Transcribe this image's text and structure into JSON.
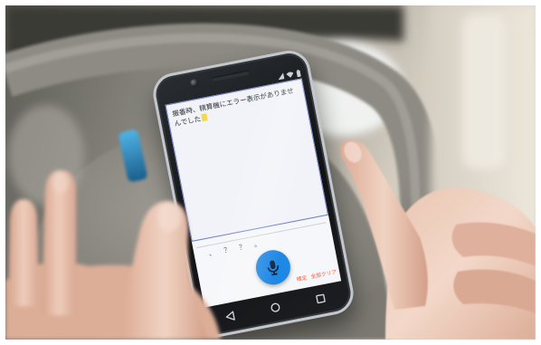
{
  "screen": {
    "message": "搬番時、精算機にエラー表示がありませんでした",
    "punctuation": [
      "、",
      "？",
      "？",
      "。"
    ],
    "confirm_label": "確定",
    "clear_label": "全部クリア"
  },
  "icons": {
    "mic": "microphone-icon",
    "back": "back-icon",
    "home": "home-icon",
    "recents": "recents-icon",
    "signal": "signal-icon",
    "wifi": "wifi-icon",
    "battery": "battery-icon"
  },
  "colors": {
    "mic_button": "#1e88e5",
    "action_text": "#e8653f",
    "field_border": "#6d7fd0",
    "cursor": "#f5d94a"
  }
}
